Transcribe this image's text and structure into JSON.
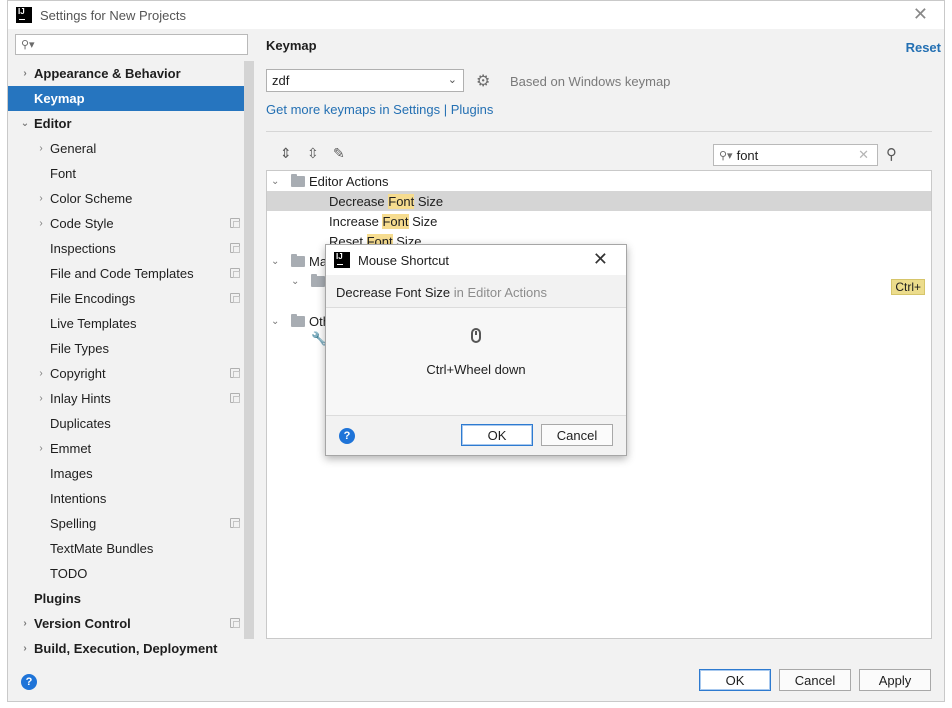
{
  "window": {
    "title": "Settings for New Projects",
    "logo_text": "IJ"
  },
  "sidebar": {
    "search_placeholder": "",
    "items": [
      {
        "label": "Appearance & Behavior",
        "level": 0,
        "bold": true,
        "arrow": "›",
        "copy": false,
        "selected": false
      },
      {
        "label": "Keymap",
        "level": 0,
        "bold": true,
        "arrow": "",
        "copy": false,
        "selected": true
      },
      {
        "label": "Editor",
        "level": 0,
        "bold": true,
        "arrow": "⌄",
        "copy": false,
        "selected": false
      },
      {
        "label": "General",
        "level": 1,
        "bold": false,
        "arrow": "›",
        "copy": false,
        "selected": false
      },
      {
        "label": "Font",
        "level": 1,
        "bold": false,
        "arrow": "",
        "copy": false,
        "selected": false
      },
      {
        "label": "Color Scheme",
        "level": 1,
        "bold": false,
        "arrow": "›",
        "copy": false,
        "selected": false
      },
      {
        "label": "Code Style",
        "level": 1,
        "bold": false,
        "arrow": "›",
        "copy": true,
        "selected": false
      },
      {
        "label": "Inspections",
        "level": 1,
        "bold": false,
        "arrow": "",
        "copy": true,
        "selected": false
      },
      {
        "label": "File and Code Templates",
        "level": 1,
        "bold": false,
        "arrow": "",
        "copy": true,
        "selected": false
      },
      {
        "label": "File Encodings",
        "level": 1,
        "bold": false,
        "arrow": "",
        "copy": true,
        "selected": false
      },
      {
        "label": "Live Templates",
        "level": 1,
        "bold": false,
        "arrow": "",
        "copy": false,
        "selected": false
      },
      {
        "label": "File Types",
        "level": 1,
        "bold": false,
        "arrow": "",
        "copy": false,
        "selected": false
      },
      {
        "label": "Copyright",
        "level": 1,
        "bold": false,
        "arrow": "›",
        "copy": true,
        "selected": false
      },
      {
        "label": "Inlay Hints",
        "level": 1,
        "bold": false,
        "arrow": "›",
        "copy": true,
        "selected": false
      },
      {
        "label": "Duplicates",
        "level": 1,
        "bold": false,
        "arrow": "",
        "copy": false,
        "selected": false
      },
      {
        "label": "Emmet",
        "level": 1,
        "bold": false,
        "arrow": "›",
        "copy": false,
        "selected": false
      },
      {
        "label": "Images",
        "level": 1,
        "bold": false,
        "arrow": "",
        "copy": false,
        "selected": false
      },
      {
        "label": "Intentions",
        "level": 1,
        "bold": false,
        "arrow": "",
        "copy": false,
        "selected": false
      },
      {
        "label": "Spelling",
        "level": 1,
        "bold": false,
        "arrow": "",
        "copy": true,
        "selected": false
      },
      {
        "label": "TextMate Bundles",
        "level": 1,
        "bold": false,
        "arrow": "",
        "copy": false,
        "selected": false
      },
      {
        "label": "TODO",
        "level": 1,
        "bold": false,
        "arrow": "",
        "copy": false,
        "selected": false
      },
      {
        "label": "Plugins",
        "level": 0,
        "bold": true,
        "arrow": "",
        "copy": false,
        "selected": false
      },
      {
        "label": "Version Control",
        "level": 0,
        "bold": true,
        "arrow": "›",
        "copy": true,
        "selected": false
      },
      {
        "label": "Build, Execution, Deployment",
        "level": 0,
        "bold": true,
        "arrow": "›",
        "copy": false,
        "selected": false
      }
    ]
  },
  "keymap": {
    "title": "Keymap",
    "reset_label": "Reset",
    "selected_keymap": "zdf",
    "based_on": "Based on Windows keymap",
    "get_more_text": "Get more keymaps in Settings | Plugins",
    "search_value": "font",
    "group": "Editor Actions",
    "actions": [
      {
        "prefix": "Decrease ",
        "match": "Font",
        "suffix": " Size"
      },
      {
        "prefix": "Increase ",
        "match": "Font",
        "suffix": " Size"
      },
      {
        "prefix": "Reset ",
        "match": "Font",
        "suffix": " Size"
      }
    ],
    "group2_partial": "Ma",
    "group3_partial": "Oth",
    "shortcut_badge": "Ctrl+"
  },
  "dialog": {
    "title": "Mouse Shortcut",
    "action_name": "Decrease Font Size",
    "action_context": " in Editor Actions",
    "shortcut": "Ctrl+Wheel down",
    "ok_label": "OK",
    "cancel_label": "Cancel"
  },
  "footer": {
    "ok_label": "OK",
    "cancel_label": "Cancel",
    "apply_label": "Apply"
  },
  "colors": {
    "accent": "#2675bf",
    "link": "#2470b3",
    "highlight": "#f6dc8f"
  }
}
